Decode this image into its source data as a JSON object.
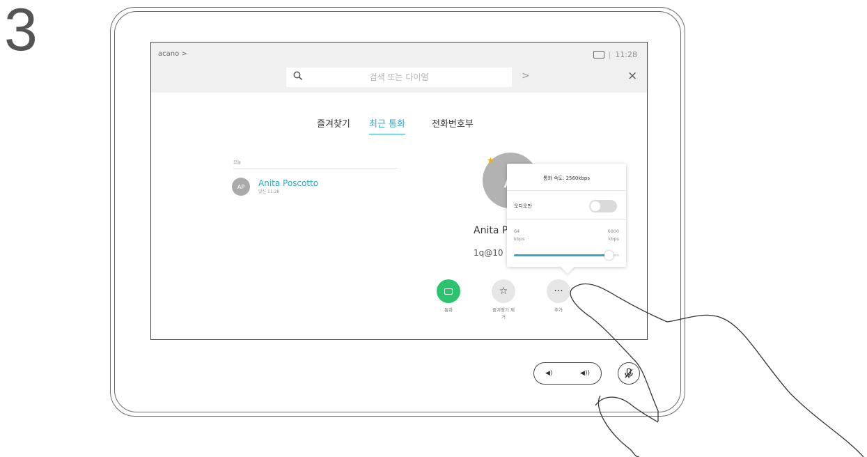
{
  "step_number": "3",
  "header": {
    "brand": "acano >",
    "clock": "11:28",
    "separator": "|"
  },
  "search": {
    "placeholder": "검색 또는 다이얼",
    "go": ">",
    "close": "×"
  },
  "tabs": [
    {
      "label": "즐겨찾기",
      "active": false
    },
    {
      "label": "최근 통화",
      "active": true
    },
    {
      "label": "전화번호부",
      "active": false
    }
  ],
  "recents": {
    "section": "오늘",
    "items": [
      {
        "initials": "AP",
        "name": "Anita Poscotto",
        "sub": "발신 11:28"
      }
    ]
  },
  "detail": {
    "initials": "A",
    "name": "Anita P",
    "address": "1q@10",
    "actions": [
      {
        "label": "통화"
      },
      {
        "label": "즐겨찾기 제\n거"
      },
      {
        "label": "추가"
      }
    ]
  },
  "popup": {
    "title": "통화 속도: 2560kbps",
    "audio_only": "오디오만",
    "audio_only_on": false,
    "min": "64\nkbps",
    "max": "6000\nkbps",
    "rate_kbps": 5400,
    "rate_min": 64,
    "rate_max": 6000
  },
  "colors": {
    "accent": "#2fa9c6",
    "call": "#2bc36e",
    "favorite": "#f0b400"
  },
  "icons": {
    "search": "search-icon",
    "close": "close-icon",
    "camera": "camera-icon",
    "star": "star-icon",
    "more": "more-icon",
    "mute": "mic-mute-icon",
    "volume": "volume-icon"
  }
}
